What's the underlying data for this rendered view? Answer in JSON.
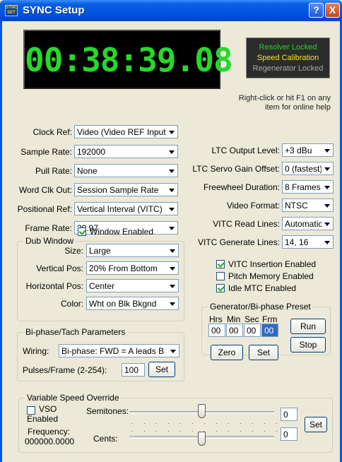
{
  "window": {
    "title": "SYNC Setup",
    "icon_text": "SYNC SET",
    "help_button": "?",
    "close_button": "X"
  },
  "timecode": "00:38:39.08",
  "status": {
    "lines": [
      {
        "text": "Resolver Locked",
        "color": "#22D422"
      },
      {
        "text": "Speed Calibration",
        "color": "#F5E625"
      },
      {
        "text": "Regenerator Locked",
        "color": "#A9A9A9"
      }
    ]
  },
  "help_note": "Right-click or hit F1 on any item for online help",
  "left_fields": [
    {
      "label": "Clock Ref:",
      "value": "Video (Video REF Input)"
    },
    {
      "label": "Sample Rate:",
      "value": "192000"
    },
    {
      "label": "Pull Rate:",
      "value": "None"
    },
    {
      "label": "Word Clk Out:",
      "value": "Session Sample Rate"
    },
    {
      "label": "Positional Ref:",
      "value": "Vertical Interval (VITC)"
    },
    {
      "label": "Frame Rate:",
      "value": "29.97"
    }
  ],
  "right_fields": [
    {
      "label": "LTC Output Level:",
      "value": "+3 dBu"
    },
    {
      "label": "LTC Servo Gain Offset:",
      "value": "0 (fastest)"
    },
    {
      "label": "Freewheel Duration:",
      "value": "8 Frames"
    },
    {
      "label": "Video Format:",
      "value": "NTSC"
    },
    {
      "label": "VITC Read Lines:",
      "value": "Automatic"
    },
    {
      "label": "VITC Generate Lines:",
      "value": "14, 16"
    }
  ],
  "dub_window": {
    "title": "Dub Window",
    "enabled_label": "Window Enabled",
    "enabled": true,
    "fields": [
      {
        "label": "Size:",
        "value": "Large"
      },
      {
        "label": "Vertical Pos:",
        "value": "20% From Bottom"
      },
      {
        "label": "Horizontal Pos:",
        "value": "Center"
      },
      {
        "label": "Color:",
        "value": "Wht on Blk Bkgnd"
      }
    ]
  },
  "options": [
    {
      "label": "VITC Insertion Enabled",
      "checked": true
    },
    {
      "label": "Pitch Memory Enabled",
      "checked": false
    },
    {
      "label": "Idle MTC Enabled",
      "checked": true
    }
  ],
  "generator": {
    "title": "Generator/Bi-phase Preset",
    "headers": [
      "Hrs",
      "Min",
      "Sec",
      "Frm"
    ],
    "values": [
      "00",
      "00",
      "00",
      "00"
    ],
    "run": "Run",
    "stop": "Stop",
    "zero": "Zero",
    "set": "Set"
  },
  "biphase": {
    "title": "Bi-phase/Tach Parameters",
    "wiring_label": "Wiring:",
    "wiring_value": "Bi-phase: FWD = A leads B",
    "pulses_label": "Pulses/Frame (2-254):",
    "pulses_value": "100",
    "set": "Set"
  },
  "vso": {
    "title": "Variable Speed Override",
    "enabled_label": "VSO Enabled",
    "enabled": false,
    "semitones_label": "Semitones:",
    "cents_label": "Cents:",
    "frequency_label": "Frequency:",
    "frequency_value": "000000.0000",
    "semitones_value": "0",
    "cents_value": "0",
    "semitones_level": 0.5,
    "cents_level": 0.5,
    "tick_marks": ". . . . . . . . . . . . .",
    "set": "Set"
  }
}
